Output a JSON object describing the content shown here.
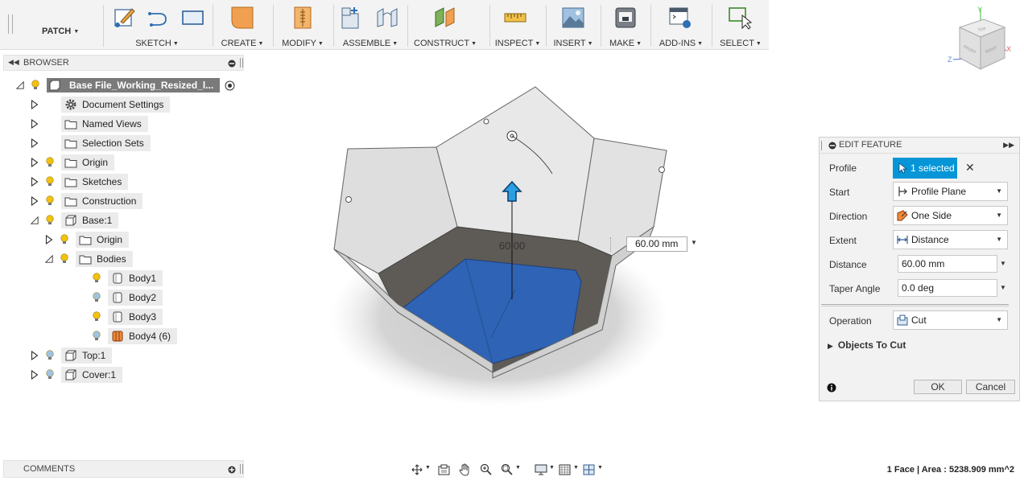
{
  "toolbar": {
    "workspace": "PATCH",
    "groups": [
      {
        "id": "sketch",
        "label": "SKETCH"
      },
      {
        "id": "create",
        "label": "CREATE"
      },
      {
        "id": "modify",
        "label": "MODIFY"
      },
      {
        "id": "assemble",
        "label": "ASSEMBLE"
      },
      {
        "id": "construct",
        "label": "CONSTRUCT"
      },
      {
        "id": "inspect",
        "label": "INSPECT"
      },
      {
        "id": "insert",
        "label": "INSERT"
      },
      {
        "id": "make",
        "label": "MAKE"
      },
      {
        "id": "addins",
        "label": "ADD-INS"
      },
      {
        "id": "select",
        "label": "SELECT"
      }
    ]
  },
  "browser": {
    "title": "BROWSER",
    "items": [
      {
        "label": "Base File_Working_Resized_l...",
        "type": "root"
      },
      {
        "label": "Document Settings",
        "type": "gear"
      },
      {
        "label": "Named Views",
        "type": "folder"
      },
      {
        "label": "Selection Sets",
        "type": "folder"
      },
      {
        "label": "Origin",
        "type": "folder"
      },
      {
        "label": "Sketches",
        "type": "folder"
      },
      {
        "label": "Construction",
        "type": "folder"
      },
      {
        "label": "Base:1",
        "type": "component"
      },
      {
        "label": "Origin",
        "type": "folder"
      },
      {
        "label": "Bodies",
        "type": "folder"
      },
      {
        "label": "Body1",
        "type": "body"
      },
      {
        "label": "Body2",
        "type": "body"
      },
      {
        "label": "Body3",
        "type": "body"
      },
      {
        "label": "Body4 (6)",
        "type": "body-orange"
      },
      {
        "label": "Top:1",
        "type": "component"
      },
      {
        "label": "Cover:1",
        "type": "component"
      }
    ]
  },
  "comments": {
    "title": "COMMENTS"
  },
  "viewport": {
    "dimension_label": "60.00",
    "distance_input": "60.00 mm",
    "viewcube": {
      "top": "TOP",
      "front": "FRONT",
      "right": "RIGHT",
      "axis_x": "X",
      "axis_y": "Y",
      "axis_z": "Z"
    }
  },
  "edit_feature": {
    "title": "EDIT FEATURE",
    "profile_label": "Profile",
    "profile_value": "1 selected",
    "start_label": "Start",
    "start_value": "Profile Plane",
    "direction_label": "Direction",
    "direction_value": "One Side",
    "extent_label": "Extent",
    "extent_value": "Distance",
    "distance_label": "Distance",
    "distance_value": "60.00 mm",
    "taper_label": "Taper Angle",
    "taper_value": "0.0 deg",
    "operation_label": "Operation",
    "operation_value": "Cut",
    "objects_to_cut": "Objects To Cut",
    "ok": "OK",
    "cancel": "Cancel"
  },
  "status": "1 Face | Area : 5238.909 mm^2",
  "colors": {
    "accent": "#0696d7",
    "selected_face": "#2e63b5",
    "bulb": "#f2c20d"
  }
}
